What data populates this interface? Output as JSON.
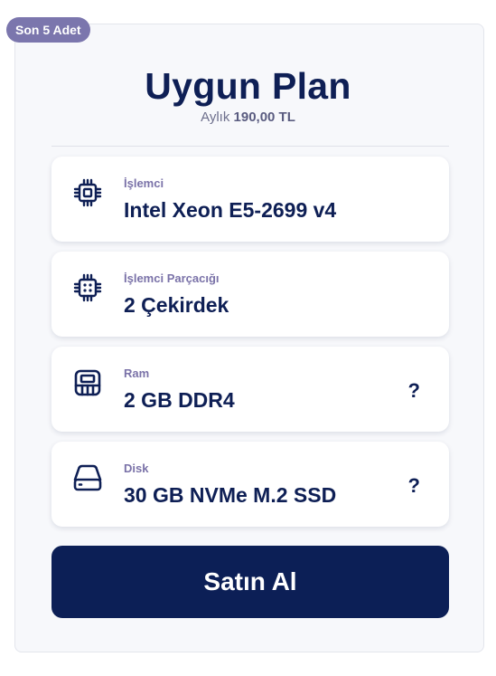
{
  "badge": "Son 5 Adet",
  "plan": {
    "title": "Uygun Plan",
    "price_prefix": "Aylık",
    "price": "190,00 TL"
  },
  "specs": [
    {
      "label": "İşlemci",
      "value": "Intel Xeon E5-2699 v4",
      "icon": "cpu-icon",
      "help": ""
    },
    {
      "label": "İşlemci Parçacığı",
      "value": "2 Çekirdek",
      "icon": "cpu-cores-icon",
      "help": ""
    },
    {
      "label": "Ram",
      "value": "2 GB DDR4",
      "icon": "ram-icon",
      "help": "?"
    },
    {
      "label": "Disk",
      "value": "30 GB NVMe M.2 SSD",
      "icon": "disk-icon",
      "help": "?"
    }
  ],
  "buy_button": "Satın Al",
  "colors": {
    "primary": "#0c1f56",
    "badge": "#7b76ad",
    "label": "#7a72a8"
  }
}
